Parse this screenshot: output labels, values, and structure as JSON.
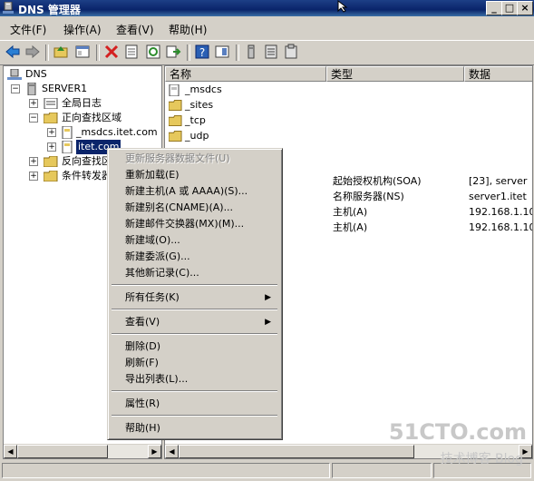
{
  "window": {
    "title": "DNS 管理器",
    "minimize": "_",
    "maximize": "□",
    "close": "×"
  },
  "menubar": [
    "文件(F)",
    "操作(A)",
    "查看(V)",
    "帮助(H)"
  ],
  "toolbar_icons": [
    "back-arrow-icon",
    "forward-arrow-icon",
    "up-folder-icon",
    "show-hide-tree-icon",
    "delete-icon",
    "properties-icon",
    "refresh-icon",
    "export-icon",
    "help-icon",
    "view-icon",
    "server-icon",
    "list-icon",
    "clipboard-icon"
  ],
  "tree": {
    "root": "DNS",
    "server": "SERVER1",
    "global_logs": "全局日志",
    "forward_zones": "正向查找区域",
    "msdcs_zone": "_msdcs.itet.com",
    "itet_zone": "itet.com",
    "reverse_zones": "反向查找区",
    "conditional_forwarders": "条件转发器"
  },
  "list": {
    "headers": [
      "名称",
      "类型",
      "数据"
    ],
    "folders": [
      "_msdcs",
      "_sites",
      "_tcp",
      "_udp"
    ],
    "records": [
      {
        "type": "起始授权机构(SOA)",
        "data": "[23], server"
      },
      {
        "type": "名称服务器(NS)",
        "data": "server1.itet"
      },
      {
        "type": "主机(A)",
        "data": "192.168.1.10"
      },
      {
        "type": "主机(A)",
        "data": "192.168.1.10"
      }
    ]
  },
  "context_menu": {
    "update_file": "更新服务器数据文件(U)",
    "reload": "重新加载(E)",
    "new_host": "新建主机(A 或 AAAA)(S)...",
    "new_alias": "新建别名(CNAME)(A)...",
    "new_mx": "新建邮件交换器(MX)(M)...",
    "new_domain": "新建域(O)...",
    "new_delegation": "新建委派(G)...",
    "other_records": "其他新记录(C)...",
    "all_tasks": "所有任务(K)",
    "view": "查看(V)",
    "delete": "删除(D)",
    "refresh": "刷新(F)",
    "export_list": "导出列表(L)...",
    "properties": "属性(R)",
    "help": "帮助(H)"
  },
  "watermark": {
    "site": "51CTO.com",
    "sub": "技术博客  Blog"
  }
}
